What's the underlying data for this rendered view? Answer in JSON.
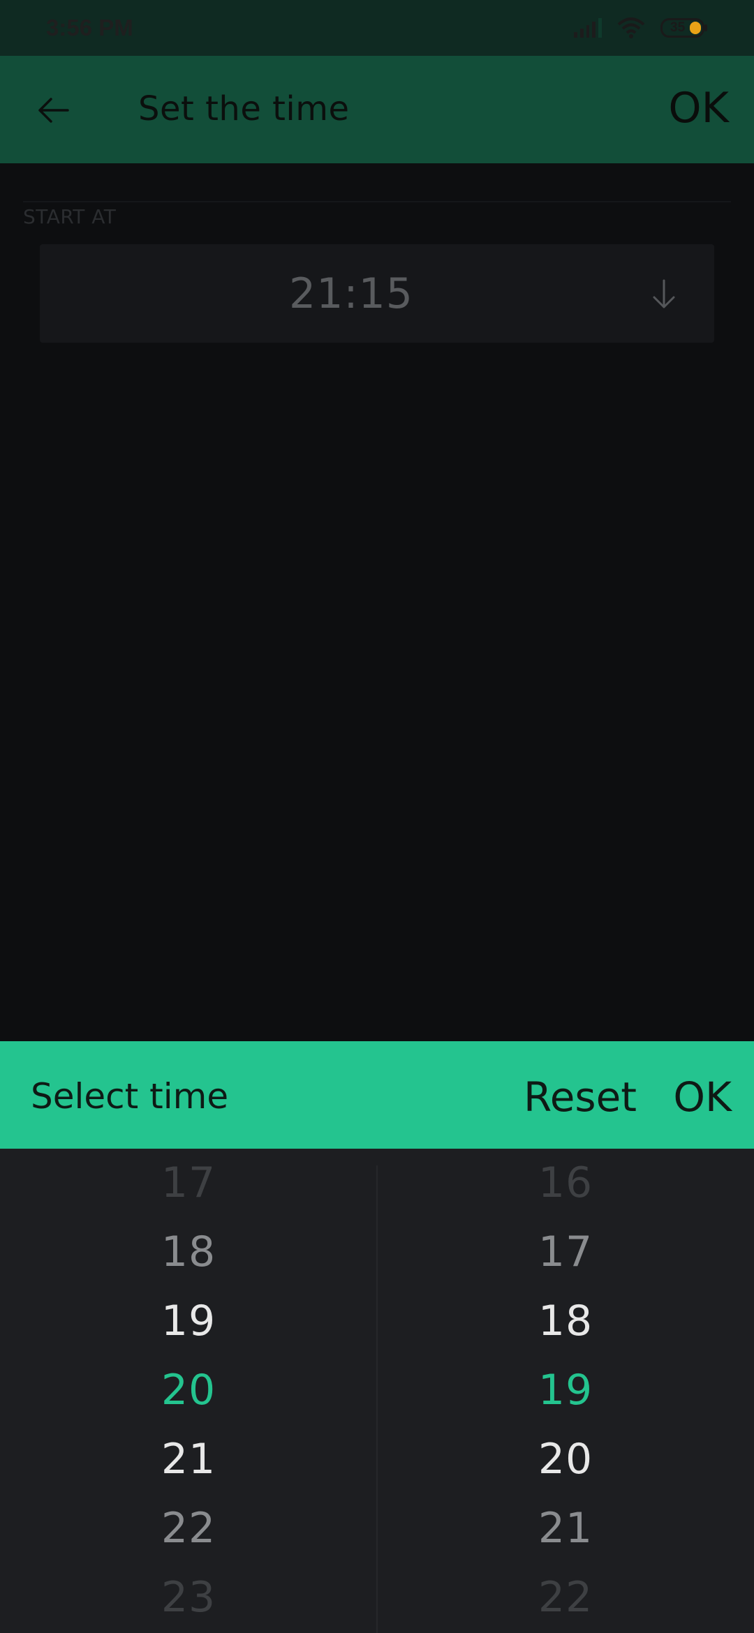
{
  "status_bar": {
    "time": "3:56 PM",
    "battery_level": "35",
    "icons": [
      "signal-icon",
      "wifi-icon",
      "battery-icon"
    ]
  },
  "app_bar": {
    "back_icon": "arrow-left-icon",
    "title": "Set the time",
    "ok_label": "OK"
  },
  "form": {
    "section_label": "START AT",
    "time_value": "21:15",
    "dropdown_icon": "arrow-down-icon"
  },
  "time_picker": {
    "title": "Select time",
    "reset_label": "Reset",
    "ok_label": "OK",
    "hours": [
      "17",
      "18",
      "19",
      "20",
      "21",
      "22",
      "23"
    ],
    "minutes": [
      "16",
      "17",
      "18",
      "19",
      "20",
      "21",
      "22"
    ],
    "selected_hour": "20",
    "selected_minute": "19"
  },
  "colors": {
    "accent": "#24c48f",
    "app_bar": "#124e39",
    "status_bar": "#0f2a22",
    "background": "#0d0e10",
    "picker_background": "#1d1e21"
  }
}
